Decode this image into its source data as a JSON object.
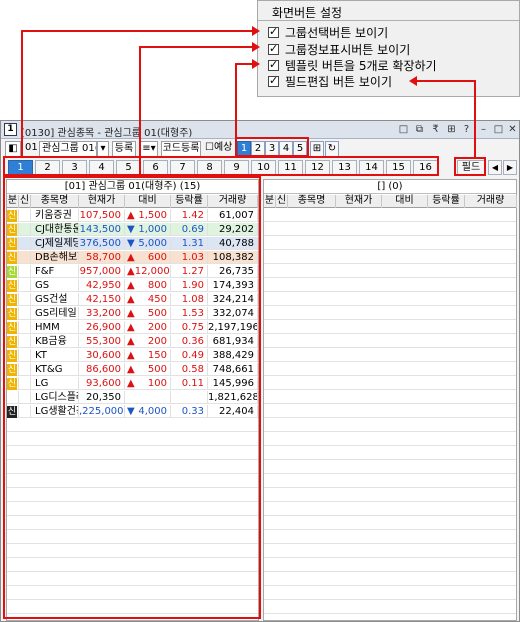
{
  "settings": {
    "title": "화면버튼 설정",
    "options": [
      {
        "label": "그룹선택버튼 보이기",
        "checked": true
      },
      {
        "label": "그룹정보표시버튼 보이기",
        "checked": true
      },
      {
        "label": "템플릿 버튼을 5개로 확장하기",
        "checked": true
      },
      {
        "label": "필드편집 버튼 보이기",
        "checked": true
      }
    ]
  },
  "window": {
    "title": "[0130] 관심종목 - 관심그룹 01(대형주)",
    "app_icon": "1",
    "buttons": [
      "□",
      "⧉",
      "₹",
      "⊞",
      "?",
      "–",
      "□",
      "✕"
    ]
  },
  "toolbar": {
    "group_num": "01",
    "group_name": "관심그룹 01(",
    "register": "등록",
    "code_register": "코드등록",
    "forecast": "예상",
    "template_pages": [
      "1",
      "2",
      "3",
      "4",
      "5"
    ],
    "active_page": "1"
  },
  "tabs": {
    "items": [
      "1",
      "2",
      "3",
      "4",
      "5",
      "6",
      "7",
      "8",
      "9",
      "10",
      "11",
      "12",
      "13",
      "14",
      "15",
      "16"
    ],
    "active": "1",
    "field_button": "필드",
    "prev": "◀",
    "next": "▶"
  },
  "left_pane": {
    "header": "[01] 관심그룹 01(대형주) (15)",
    "columns": [
      "분",
      "신",
      "종목명",
      "현재가",
      "대비",
      "등락률",
      "거래량"
    ],
    "rows": [
      {
        "badge": "신",
        "badge_color": "#f0b400",
        "name": "키움증권",
        "price": "107,500",
        "dir": "up",
        "change": "1,500",
        "rate": "1.42",
        "volume": "61,007",
        "bg": ""
      },
      {
        "badge": "신",
        "badge_color": "#f0b400",
        "name": "CJ대한통운",
        "price": "143,500",
        "dir": "down",
        "change": "1,000",
        "rate": "0.69",
        "volume": "29,202",
        "bg": "#dff4df"
      },
      {
        "badge": "신",
        "badge_color": "#f0b400",
        "name": "CJ제일제당",
        "price": "376,500",
        "dir": "down",
        "change": "5,000",
        "rate": "1.31",
        "volume": "40,788",
        "bg": "#dbe5f3"
      },
      {
        "badge": "신",
        "badge_color": "#f0b400",
        "name": "DB손해보험",
        "price": "58,700",
        "dir": "up",
        "change": "600",
        "rate": "1.03",
        "volume": "108,382",
        "bg": "#f8e1cf"
      },
      {
        "badge": "신",
        "badge_color": "#a8d838",
        "name": "F&F",
        "price": "957,000",
        "dir": "up",
        "change": "12,000",
        "rate": "1.27",
        "volume": "26,735",
        "bg": ""
      },
      {
        "badge": "신",
        "badge_color": "#f0b400",
        "name": "GS",
        "price": "42,950",
        "dir": "up",
        "change": "800",
        "rate": "1.90",
        "volume": "174,393",
        "bg": ""
      },
      {
        "badge": "신",
        "badge_color": "#f0b400",
        "name": "GS건설",
        "price": "42,150",
        "dir": "up",
        "change": "450",
        "rate": "1.08",
        "volume": "324,214",
        "bg": ""
      },
      {
        "badge": "신",
        "badge_color": "#f0b400",
        "name": "GS리테일",
        "price": "33,200",
        "dir": "up",
        "change": "500",
        "rate": "1.53",
        "volume": "332,074",
        "bg": ""
      },
      {
        "badge": "신",
        "badge_color": "#f0b400",
        "name": "HMM",
        "price": "26,900",
        "dir": "up",
        "change": "200",
        "rate": "0.75",
        "volume": "2,197,196",
        "bg": ""
      },
      {
        "badge": "신",
        "badge_color": "#f0b400",
        "name": "KB금융",
        "price": "55,300",
        "dir": "up",
        "change": "200",
        "rate": "0.36",
        "volume": "681,934",
        "bg": ""
      },
      {
        "badge": "신",
        "badge_color": "#f0b400",
        "name": "KT",
        "price": "30,600",
        "dir": "up",
        "change": "150",
        "rate": "0.49",
        "volume": "388,429",
        "bg": ""
      },
      {
        "badge": "신",
        "badge_color": "#f0b400",
        "name": "KT&G",
        "price": "86,600",
        "dir": "up",
        "change": "500",
        "rate": "0.58",
        "volume": "748,661",
        "bg": ""
      },
      {
        "badge": "신",
        "badge_color": "#f0b400",
        "name": "LG",
        "price": "93,600",
        "dir": "up",
        "change": "100",
        "rate": "0.11",
        "volume": "145,996",
        "bg": ""
      },
      {
        "badge": "",
        "badge_color": "",
        "name": "LG디스플레",
        "price": "20,350",
        "dir": "",
        "change": "",
        "rate": "",
        "volume": "1,821,628",
        "bg": ""
      },
      {
        "badge": "신",
        "badge_color": "#222222",
        "name": "LG생활건강",
        "price": ",225,000",
        "dir": "down",
        "change": "4,000",
        "rate": "0.33",
        "volume": "22,404",
        "bg": ""
      }
    ]
  },
  "right_pane": {
    "header": "[]   (0)",
    "columns": [
      "분",
      "신",
      "종목명",
      "현재가",
      "대비",
      "등락률",
      "거래량"
    ]
  },
  "colors": {
    "accent": "#2f7fd7",
    "annotation": "#e01010",
    "up": "#d11111",
    "down": "#1d55c4"
  }
}
